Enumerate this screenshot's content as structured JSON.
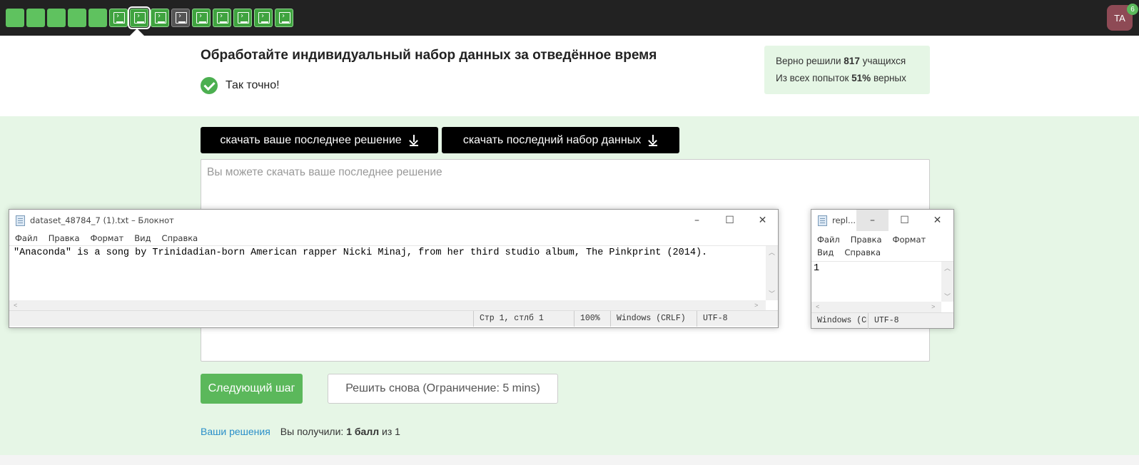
{
  "topbar": {
    "steps": [
      "solid",
      "solid",
      "solid",
      "solid",
      "solid",
      "term",
      "term",
      "term",
      "term",
      "term",
      "term",
      "term",
      "term",
      "term"
    ],
    "avatar": "TA",
    "badge": "6"
  },
  "header": {
    "title": "Обработайте индивидуальный набор данных за отведённое время",
    "status": "Так точно!",
    "stats_line1_pre": "Верно решили ",
    "stats_line1_num": "817",
    "stats_line1_post": " учащихся",
    "stats_line2_pre": "Из всех попыток ",
    "stats_line2_num": "51%",
    "stats_line2_post": " верных"
  },
  "buttons": {
    "download_solution": "скачать ваше последнее решение",
    "download_dataset": "скачать последний набор данных",
    "next_step": "Следующий шаг",
    "retry": "Решить снова (Ограничение: 5 mins)"
  },
  "answer": {
    "placeholder": "Вы можете скачать ваше последнее решение"
  },
  "score": {
    "link": "Ваши решения",
    "pre": "Вы получили: ",
    "value": "1 балл",
    "post": " из 1"
  },
  "notepad1": {
    "title": "dataset_48784_7 (1).txt – Блокнот",
    "menu": [
      "Файл",
      "Правка",
      "Формат",
      "Вид",
      "Справка"
    ],
    "content": "\"Anaconda\" is a song by Trinidadian-born American rapper Nicki Minaj, from her third studio album, The Pinkprint (2014).",
    "status_pos": "Стр 1, стлб 1",
    "status_zoom": "100%",
    "status_eol": "Windows (CRLF)",
    "status_enc": "UTF-8"
  },
  "notepad2": {
    "title": "repl...",
    "menu": [
      "Файл",
      "Правка",
      "Формат",
      "Вид",
      "Справка"
    ],
    "content": "1",
    "status_eol": "Windows (CRLF)",
    "status_enc": "UTF-8"
  }
}
